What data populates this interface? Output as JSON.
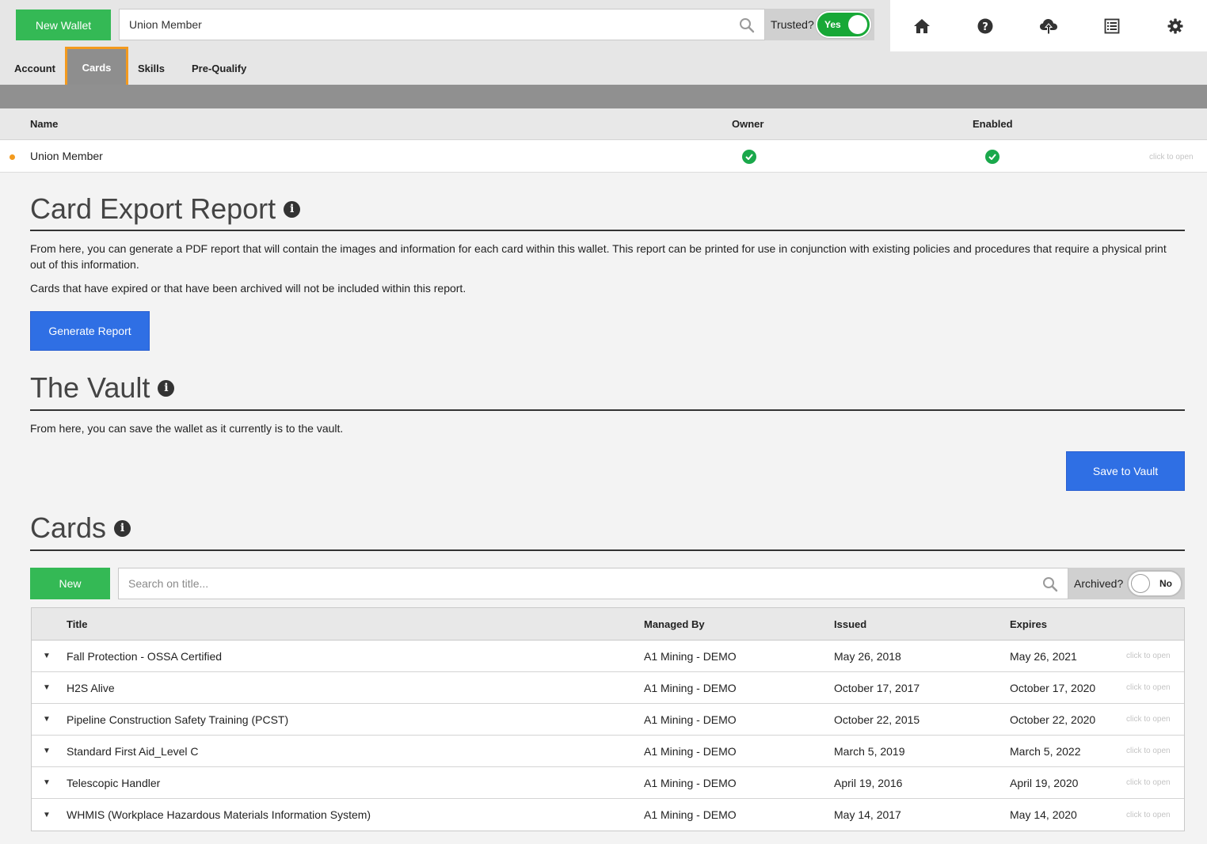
{
  "topbar": {
    "new_wallet_label": "New Wallet",
    "wallet_search_value": "Union Member",
    "trusted_label": "Trusted?",
    "trusted_toggle_label": "Yes",
    "icons": [
      "home-icon",
      "help-icon",
      "cloud-upload-icon",
      "report-list-icon",
      "gear-icon"
    ]
  },
  "tabs": [
    {
      "label": "Account",
      "active": false
    },
    {
      "label": "Cards",
      "active": true
    },
    {
      "label": "Skills",
      "active": false
    },
    {
      "label": "Pre-Qualify",
      "active": false
    }
  ],
  "wallet_table": {
    "headers": {
      "name": "Name",
      "owner": "Owner",
      "enabled": "Enabled"
    },
    "row": {
      "name": "Union Member",
      "owner": true,
      "enabled": true,
      "action": "click to open"
    }
  },
  "card_export": {
    "title": "Card Export Report",
    "paragraph1": "From here, you can generate a PDF report that will contain the images and information for each card within this wallet. This report can be printed for use in conjunction with existing policies and procedures that require a physical print out of this information.",
    "paragraph2": "Cards that have expired or that have been archived will not be included within this report.",
    "button_label": "Generate Report"
  },
  "vault": {
    "title": "The Vault",
    "paragraph": "From here, you can save the wallet as it currently is to the vault.",
    "button_label": "Save to Vault"
  },
  "cards": {
    "title": "Cards",
    "new_label": "New",
    "search_placeholder": "Search on title...",
    "archived_label": "Archived?",
    "archived_toggle_label": "No",
    "headers": {
      "title": "Title",
      "managed_by": "Managed By",
      "issued": "Issued",
      "expires": "Expires"
    },
    "rows": [
      {
        "title": "Fall Protection - OSSA Certified",
        "managed_by": "A1 Mining - DEMO",
        "issued": "May 26, 2018",
        "expires": "May 26, 2021",
        "action": "click to open"
      },
      {
        "title": "H2S Alive",
        "managed_by": "A1 Mining - DEMO",
        "issued": "October 17, 2017",
        "expires": "October 17, 2020",
        "action": "click to open"
      },
      {
        "title": "Pipeline Construction Safety Training (PCST)",
        "managed_by": "A1 Mining - DEMO",
        "issued": "October 22, 2015",
        "expires": "October 22, 2020",
        "action": "click to open"
      },
      {
        "title": "Standard First Aid_Level C",
        "managed_by": "A1 Mining - DEMO",
        "issued": "March 5, 2019",
        "expires": "March 5, 2022",
        "action": "click to open"
      },
      {
        "title": "Telescopic Handler",
        "managed_by": "A1 Mining - DEMO",
        "issued": "April 19, 2016",
        "expires": "April 19, 2020",
        "action": "click to open"
      },
      {
        "title": "WHMIS (Workplace Hazardous Materials Information System)",
        "managed_by": "A1 Mining - DEMO",
        "issued": "May 14, 2017",
        "expires": "May 14, 2020",
        "action": "click to open"
      }
    ]
  },
  "colors": {
    "green": "#34b955",
    "blue": "#2f6fe4",
    "orange": "#f39a1e",
    "check_green": "#1aa84b"
  }
}
